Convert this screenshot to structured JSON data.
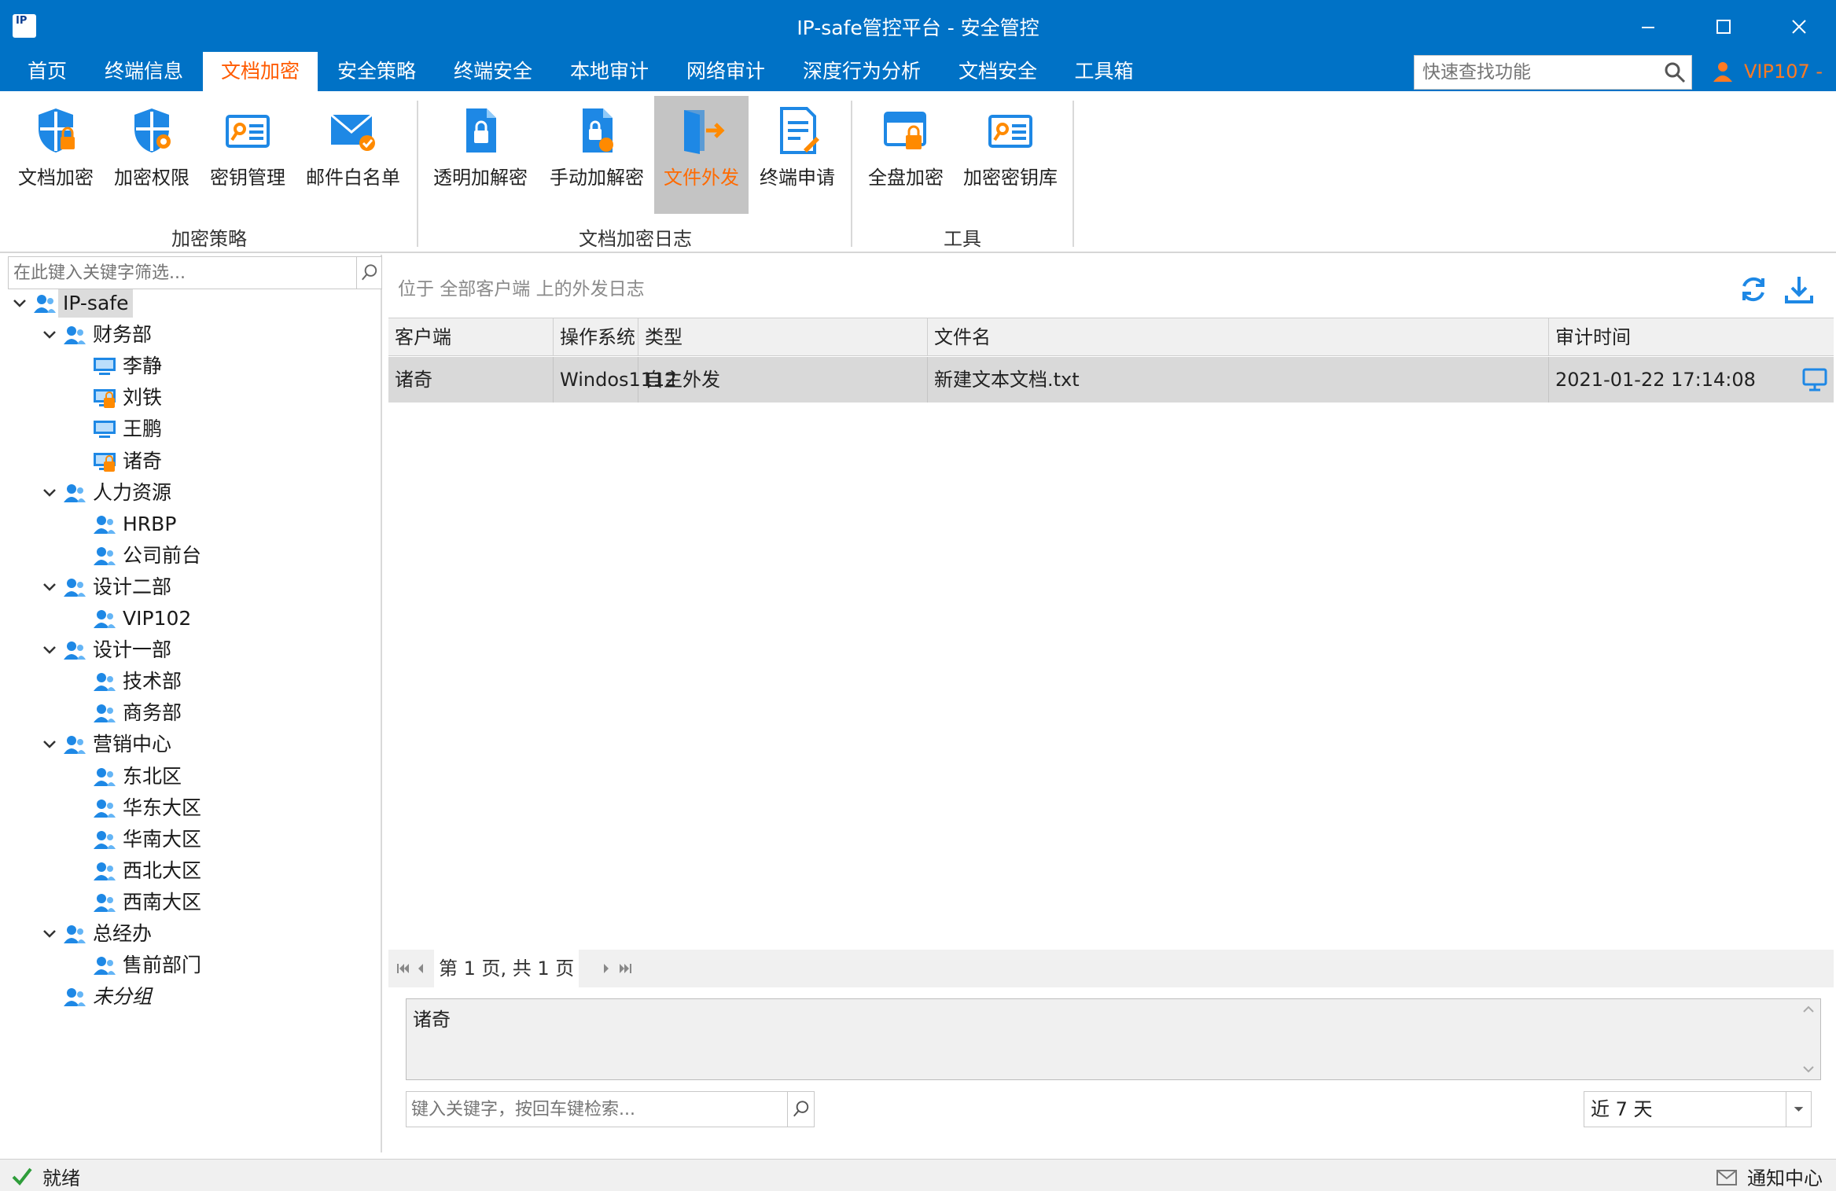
{
  "window": {
    "logo_text": "IP",
    "title": "IP-safe管控平台 - 安全管控"
  },
  "menu": {
    "items": [
      "首页",
      "终端信息",
      "文档加密",
      "安全策略",
      "终端安全",
      "本地审计",
      "网络审计",
      "深度行为分析",
      "文档安全",
      "工具箱"
    ],
    "active_index": 2,
    "search_placeholder": "快速查找功能",
    "user": "VIP107 -"
  },
  "ribbon": {
    "buttons": [
      "文档加密",
      "加密权限",
      "密钥管理",
      "邮件白名单",
      "透明加解密",
      "手动加解密",
      "文件外发",
      "终端申请",
      "全盘加密",
      "加密密钥库"
    ],
    "active_index": 6,
    "groups": [
      "加密策略",
      "文档加密日志",
      "工具"
    ]
  },
  "tree": {
    "filter_placeholder": "在此键入关键字筛选...",
    "nodes": [
      {
        "label": "IP-safe",
        "type": "group"
      },
      {
        "label": "财务部",
        "type": "group"
      },
      {
        "label": "李静",
        "type": "pc"
      },
      {
        "label": "刘铁",
        "type": "pc-locked"
      },
      {
        "label": "王鹏",
        "type": "pc"
      },
      {
        "label": "诸奇",
        "type": "pc-locked"
      },
      {
        "label": "人力资源",
        "type": "group"
      },
      {
        "label": "HRBP",
        "type": "group"
      },
      {
        "label": "公司前台",
        "type": "group"
      },
      {
        "label": "设计二部",
        "type": "group"
      },
      {
        "label": "VIP102",
        "type": "group"
      },
      {
        "label": "设计一部",
        "type": "group"
      },
      {
        "label": "技术部",
        "type": "group"
      },
      {
        "label": "商务部",
        "type": "group"
      },
      {
        "label": "营销中心",
        "type": "group"
      },
      {
        "label": "东北区",
        "type": "group"
      },
      {
        "label": "华东大区",
        "type": "group"
      },
      {
        "label": "华南大区",
        "type": "group"
      },
      {
        "label": "西北大区",
        "type": "group"
      },
      {
        "label": "西南大区",
        "type": "group"
      },
      {
        "label": "总经办",
        "type": "group"
      },
      {
        "label": "售前部门",
        "type": "group"
      },
      {
        "label": "未分组",
        "type": "group-italic"
      }
    ]
  },
  "main": {
    "breadcrumb": "位于 全部客户端 上的外发日志",
    "columns": [
      "客户端",
      "操作系统账户",
      "类型",
      "文件名",
      "审计时间"
    ],
    "rows": [
      [
        "诸奇",
        "Windos1112",
        "自主外发",
        "新建文本文档.txt",
        "2021-01-22 17:14:08"
      ]
    ],
    "pager_text": "第 1 页, 共 1 页",
    "detail_text": "诸奇",
    "keyword_placeholder": "键入关键字，按回车键检索...",
    "range_value": "近 7 天"
  },
  "status": {
    "left": "就绪",
    "right": "通知中心"
  },
  "colors": {
    "brand_blue": "#0072c6",
    "accent_orange": "#ff5a00",
    "icon_blue": "#1e88e5"
  }
}
